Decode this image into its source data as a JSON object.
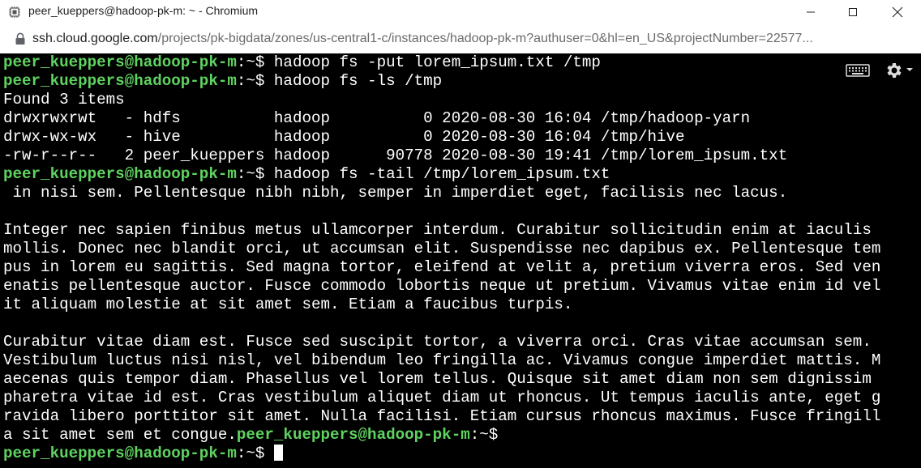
{
  "window": {
    "title": "peer_kueppers@hadoop-pk-m: ~ - Chromium"
  },
  "address": {
    "host": "ssh.cloud.google.com",
    "path": "/projects/pk-bigdata/zones/us-central1-c/instances/hadoop-pk-m?authuser=0&hl=en_US&projectNumber=22577..."
  },
  "terminal": {
    "prompt_user": "peer_kueppers@hadoop-pk-m",
    "prompt_path": ":~$ ",
    "lines": [
      {
        "type": "cmd",
        "text": "hadoop fs -put lorem_ipsum.txt /tmp"
      },
      {
        "type": "cmd",
        "text": "hadoop fs -ls /tmp"
      },
      {
        "type": "out",
        "text": "Found 3 items"
      },
      {
        "type": "out",
        "text": "drwxrwxrwt   - hdfs          hadoop          0 2020-08-30 16:04 /tmp/hadoop-yarn"
      },
      {
        "type": "out",
        "text": "drwx-wx-wx   - hive          hadoop          0 2020-08-30 16:04 /tmp/hive"
      },
      {
        "type": "out",
        "text": "-rw-r--r--   2 peer_kueppers hadoop      90778 2020-08-30 19:41 /tmp/lorem_ipsum.txt"
      },
      {
        "type": "cmd",
        "text": "hadoop fs -tail /tmp/lorem_ipsum.txt"
      },
      {
        "type": "out",
        "text": " in nisi sem. Pellentesque nibh nibh, semper in imperdiet eget, facilisis nec lacus."
      },
      {
        "type": "out",
        "text": ""
      },
      {
        "type": "out",
        "text": "Integer nec sapien finibus metus ullamcorper interdum. Curabitur sollicitudin enim at iaculis"
      },
      {
        "type": "out",
        "text": "mollis. Donec nec blandit orci, ut accumsan elit. Suspendisse nec dapibus ex. Pellentesque tem"
      },
      {
        "type": "out",
        "text": "pus in lorem eu sagittis. Sed magna tortor, eleifend at velit a, pretium viverra eros. Sed ven"
      },
      {
        "type": "out",
        "text": "enatis pellentesque auctor. Fusce commodo lobortis neque ut pretium. Vivamus vitae enim id vel"
      },
      {
        "type": "out",
        "text": "it aliquam molestie at sit amet sem. Etiam a faucibus turpis."
      },
      {
        "type": "out",
        "text": ""
      },
      {
        "type": "out",
        "text": "Curabitur vitae diam est. Fusce sed suscipit tortor, a viverra orci. Cras vitae accumsan sem."
      },
      {
        "type": "out",
        "text": "Vestibulum luctus nisi nisl, vel bibendum leo fringilla ac. Vivamus congue imperdiet mattis. M"
      },
      {
        "type": "out",
        "text": "aecenas quis tempor diam. Phasellus vel lorem tellus. Quisque sit amet diam non sem dignissim"
      },
      {
        "type": "out",
        "text": "pharetra vitae id est. Cras vestibulum aliquet diam ut rhoncus. Ut tempus iaculis ante, eget g"
      },
      {
        "type": "out",
        "text": "ravida libero porttitor sit amet. Nulla facilisi. Etiam cursus rhoncus maximus. Fusce fringill"
      },
      {
        "type": "mixed",
        "text": "a sit amet sem et congue."
      },
      {
        "type": "prompt_cursor",
        "text": ""
      }
    ]
  },
  "icons": {
    "app": "chromium-app-icon",
    "lock": "lock-icon",
    "keyboard": "keyboard-icon",
    "settings": "gear-icon"
  },
  "colors": {
    "prompt_user": "#5fd35f",
    "terminal_bg": "#000000",
    "terminal_fg": "#ffffff"
  }
}
